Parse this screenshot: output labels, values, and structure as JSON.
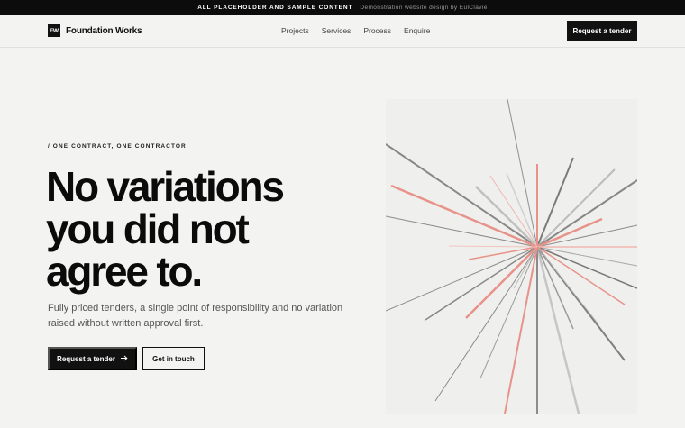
{
  "topbar": {
    "notice": "ALL PLACEHOLDER AND SAMPLE CONTENT",
    "credit": "Demonstration website design by EulClavie"
  },
  "nav": {
    "logo_mark": "FW",
    "brand": "Foundation Works",
    "links": [
      "Projects",
      "Services",
      "Process",
      "Enquire"
    ],
    "cta": "Request a tender"
  },
  "hero": {
    "eyebrow": "/ ONE CONTRACT, ONE CONTRACTOR",
    "headline": [
      "No variations",
      "you did not",
      "agree to."
    ],
    "lede": "Fully priced tenders, a single point of responsibility and no variation raised without written approval first.",
    "primary_cta": "Request a tender",
    "primary_cta_icon": "arrow-right-icon",
    "secondary_cta": "Get in touch"
  },
  "colors": {
    "ink": "#111111",
    "background": "#f3f3f1",
    "accent": "#e8938a"
  }
}
